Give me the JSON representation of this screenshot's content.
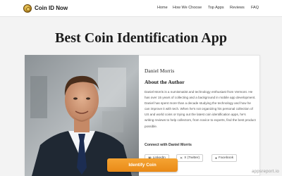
{
  "header": {
    "brand": "Coin ID Now",
    "nav": [
      {
        "label": "Home"
      },
      {
        "label": "How We Choose"
      },
      {
        "label": "Top Apps"
      },
      {
        "label": "Reviews"
      },
      {
        "label": "FAQ"
      }
    ]
  },
  "page": {
    "headline": "Best Coin Identification App"
  },
  "author": {
    "name": "Daniel Morris",
    "about_heading": "About the Author",
    "bio": "Daniel Morris is a numismatist and technology enthusiast from Vermont. He has over 15 years of collecting and a background in mobile app development. Daniel has spent more than a decade studying the technology and how he can improve it with tech. When he's not organizing his personal collection of US and world coins or trying out the latest coin identification apps, he's writing reviews to help collectors, from novice to experts, find the best product possible.",
    "connect_heading": "Connect with Daniel Morris",
    "social": [
      {
        "icon": "linkedin-icon",
        "label": "LinkedIn"
      },
      {
        "icon": "x-twitter-icon",
        "label": "X (Twitter)"
      },
      {
        "icon": "facebook-icon",
        "label": "Facebook"
      }
    ]
  },
  "cta": {
    "label": "Identify Coin",
    "color": "#ee911f"
  },
  "watermark": "appsreport.io"
}
